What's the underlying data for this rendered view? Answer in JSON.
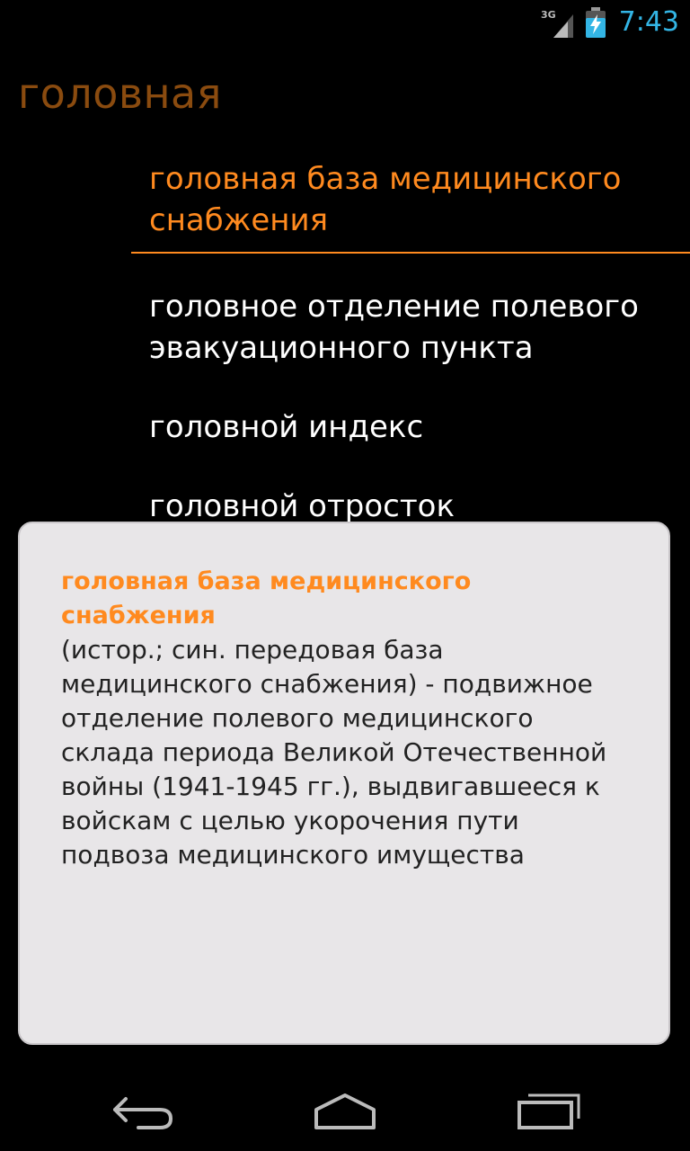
{
  "status_bar": {
    "network": "3G",
    "time": "7:43",
    "signal_icon": "signal-3g-icon",
    "battery_icon": "battery-charging-icon",
    "clock_color": "#33b5e5"
  },
  "header": {
    "query": "головная"
  },
  "results": [
    {
      "label": "головная база медицинского снабжения",
      "selected": true
    },
    {
      "label": "головное отделение полевого эвакуационного пункта",
      "selected": false
    },
    {
      "label": "головной индекс",
      "selected": false
    },
    {
      "label": "головной отросток",
      "selected": false
    }
  ],
  "popup": {
    "term": "головная база медицинского снабжения",
    "definition": "(истор.; син. передовая база медицинского снабжения) - подвижное отделение полевого медицинского склада периода Великой Отечественной войны (1941-1945 гг.), выдвигавшееся к войскам с целью укорочения пути подвоза медицинского имущества"
  },
  "nav_bar": {
    "back_icon": "back-icon",
    "home_icon": "home-icon",
    "recents_icon": "recents-icon"
  },
  "colors": {
    "accent": "#ff8a1f",
    "header": "#8a4b0f",
    "popup_bg": "#e8e6e8"
  }
}
